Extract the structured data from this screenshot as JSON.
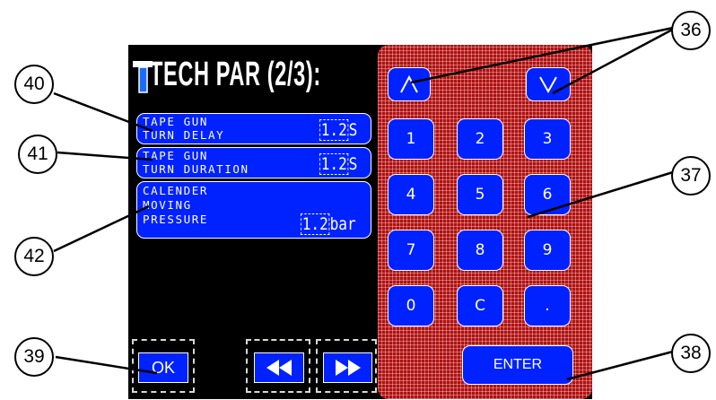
{
  "title": "TECH PAR (2/3):",
  "params": [
    {
      "line1": "TAPE GUN",
      "line2": "TURN DELAY",
      "line3": "",
      "value": "1.2",
      "unit": "S"
    },
    {
      "line1": "TAPE GUN",
      "line2": "TURN DURATION",
      "line3": "",
      "value": "1.2",
      "unit": "S"
    },
    {
      "line1": "CALENDER",
      "line2": "MOVING",
      "line3": "PRESSURE",
      "value": "1.2",
      "unit": "bar"
    }
  ],
  "keypad": {
    "keys": [
      "1",
      "2",
      "3",
      "4",
      "5",
      "6",
      "7",
      "8",
      "9",
      "0",
      "C",
      "."
    ],
    "enter_label": "ENTER"
  },
  "bottom": {
    "ok_label": "OK"
  },
  "callouts": {
    "c36": "36",
    "c37": "37",
    "c38": "38",
    "c39": "39",
    "c40": "40",
    "c41": "41",
    "c42": "42"
  },
  "colors": {
    "key_blue": "#0022ff",
    "keypad_red": "#b01010",
    "screen": "#000000"
  },
  "icons": [
    "tool-icon",
    "arrow-up-icon",
    "arrow-down-icon",
    "rewind-icon",
    "fast-forward-icon"
  ]
}
